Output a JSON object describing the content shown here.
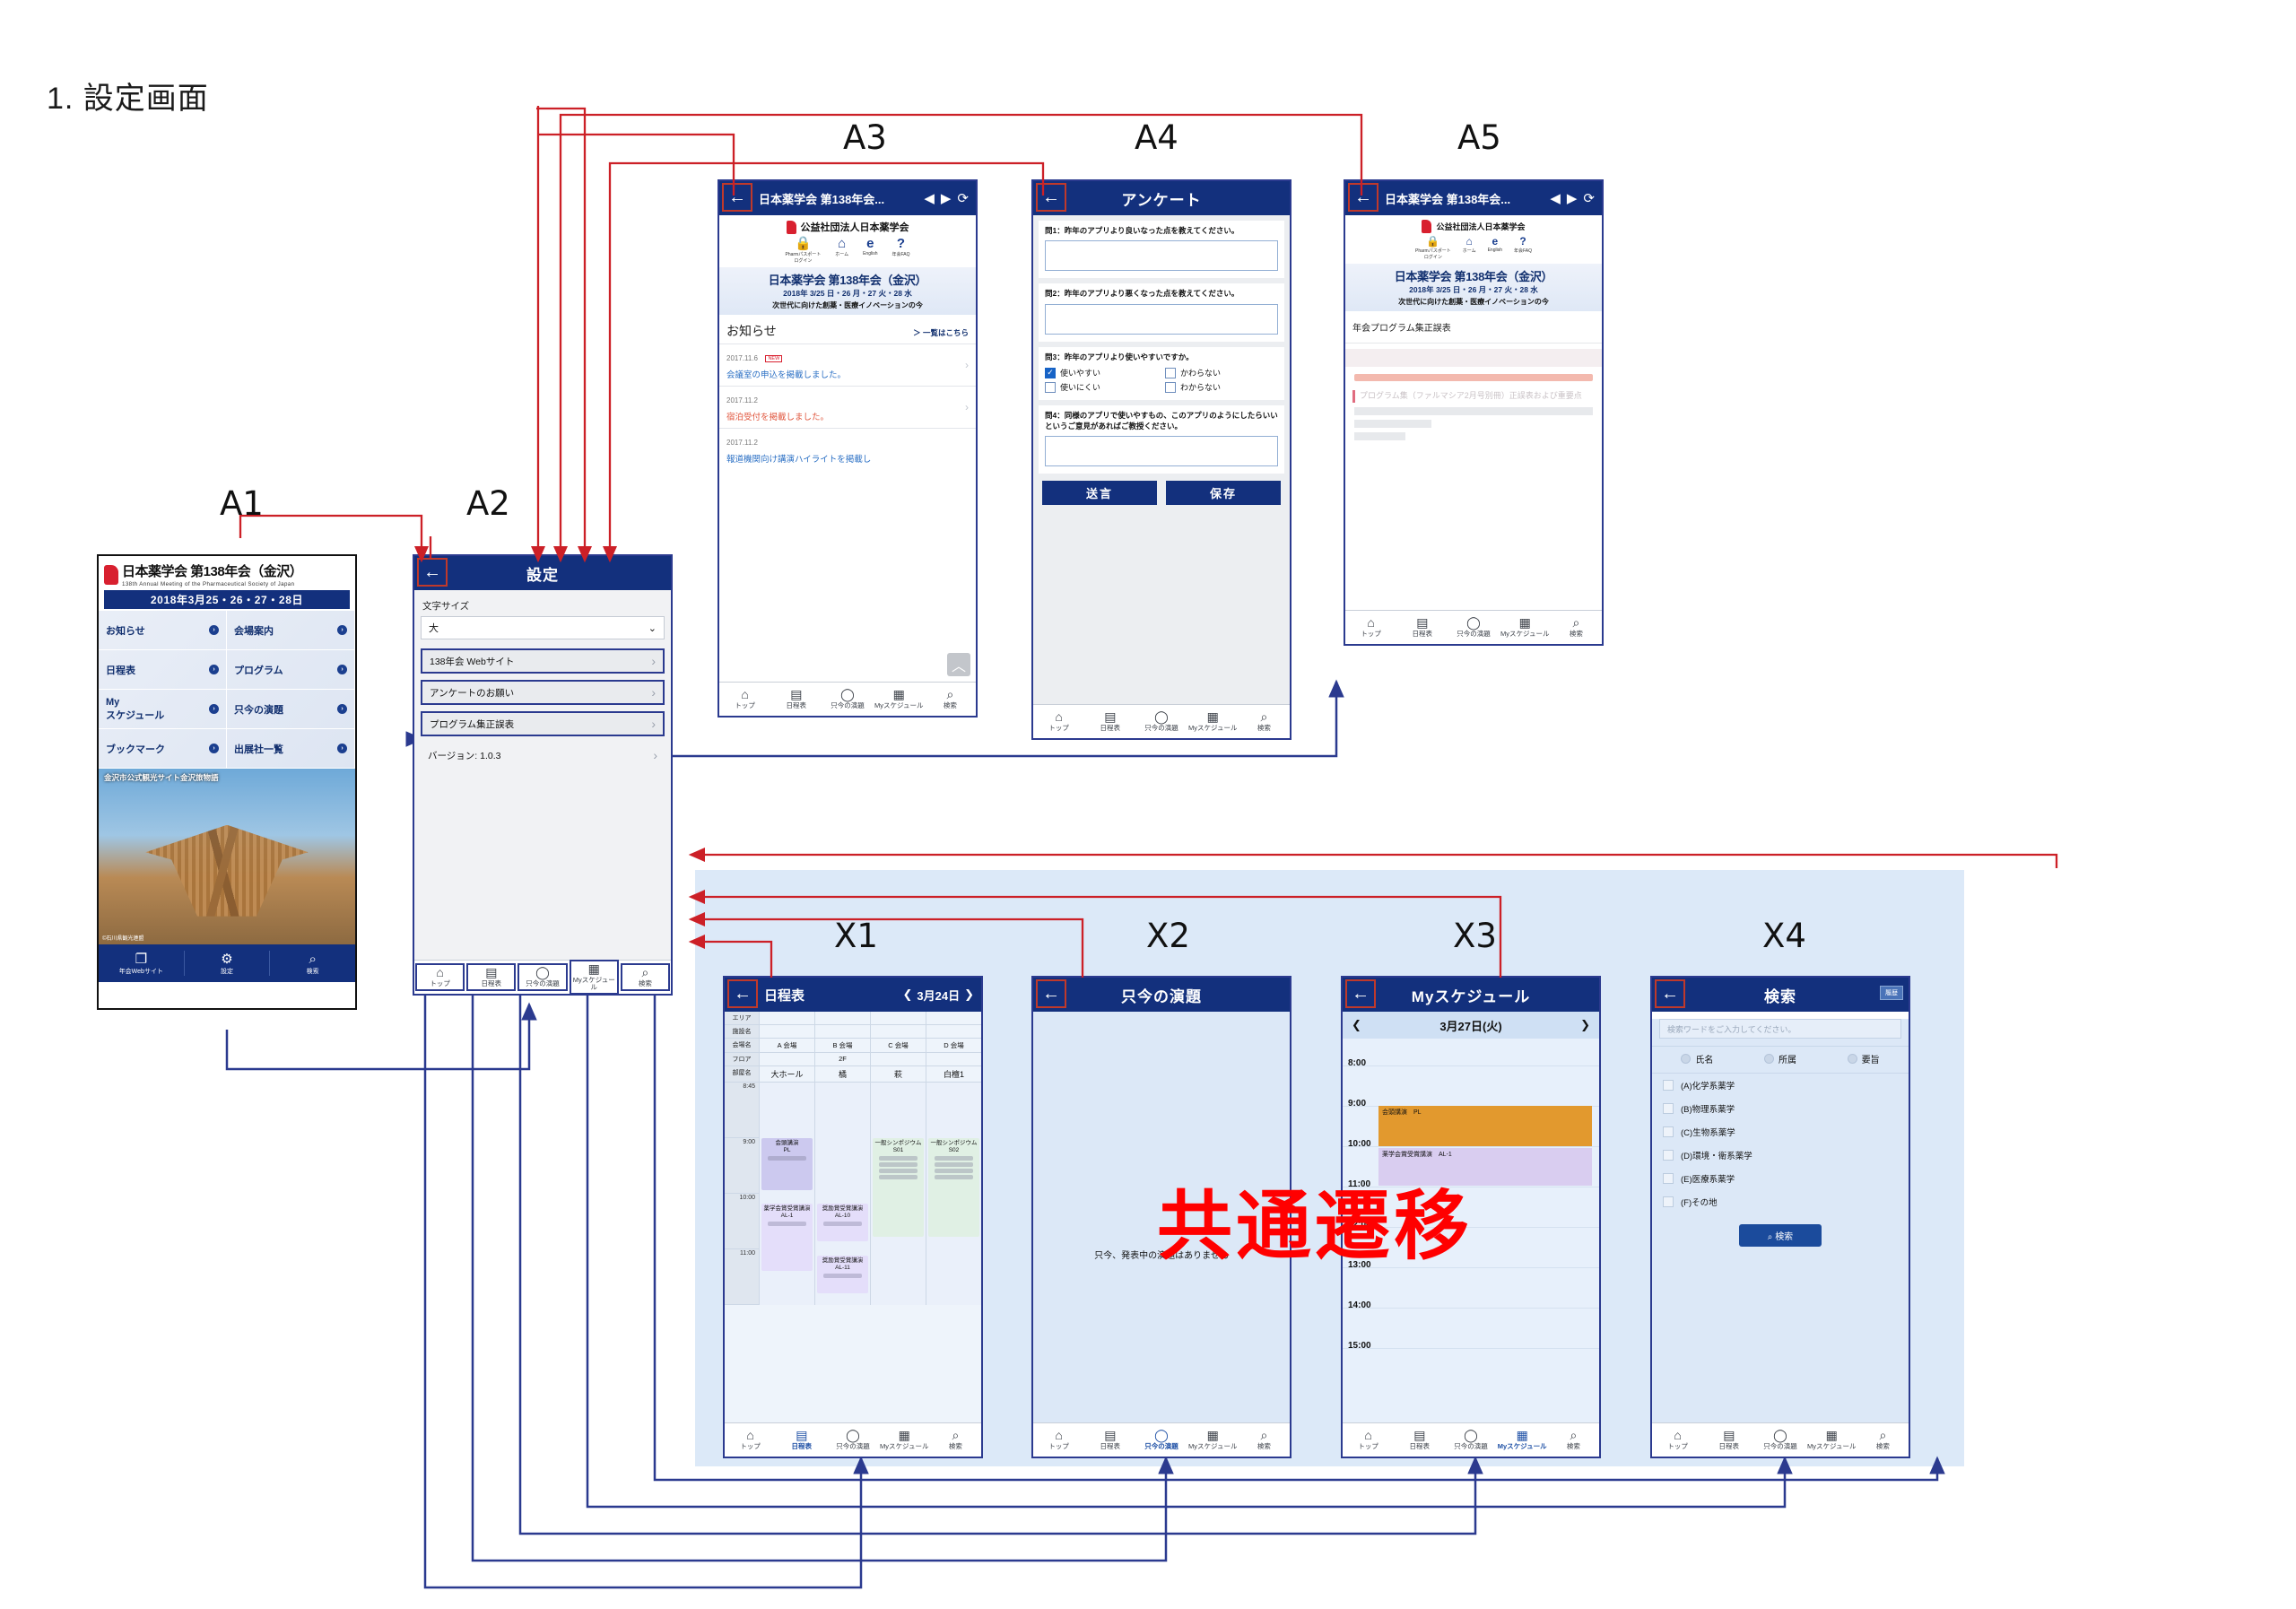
{
  "page": {
    "title": "1. 設定画面"
  },
  "watermark": "共通遷移",
  "labels": {
    "a1": "A1",
    "a2": "A2",
    "a3": "A3",
    "a4": "A4",
    "a5": "A5",
    "x1": "X1",
    "x2": "X2",
    "x3": "X3",
    "x4": "X4"
  },
  "nav": {
    "top": "トップ",
    "schedule": "日程表",
    "now": "只今の演題",
    "myschedule": "Myスケジュール",
    "search": "検索",
    "icons": {
      "top": "⌂",
      "schedule": "▤",
      "now": "◯",
      "myschedule": "▦",
      "search": "⌕"
    }
  },
  "a1": {
    "brand_title": "日本薬学会 第138年会（金沢）",
    "brand_sub": "138th Annual Meeting of the Pharmaceutical Society of Japan",
    "date_band": "2018年3月25・26・27・28日",
    "menu": [
      "お知らせ",
      "会場案内",
      "日程表",
      "プログラム",
      "My\nスケジュール",
      "只今の演題",
      "ブックマーク",
      "出展社一覧"
    ],
    "photo_caption": "金沢市公式観光サイト金沢旅物語",
    "photo_credit": "©石川県観光連盟",
    "bottom_nav": [
      "年会Webサイト",
      "設定",
      "検索"
    ],
    "bottom_icons": [
      "❐",
      "⚙",
      "⌕"
    ]
  },
  "a2": {
    "title": "設定",
    "fontsize_label": "文字サイズ",
    "fontsize_value": "大",
    "rows": [
      "138年会 Webサイト",
      "アンケートのお願い",
      "プログラム集正誤表",
      "バージョン: 1.0.3"
    ]
  },
  "a3": {
    "browser_title": "日本薬学会 第138年会...",
    "society_name": "公益社団法人日本薬学会",
    "quick_icons": [
      {
        "glyph": "🔒",
        "caption": "Pharmパスポート\nログイン"
      },
      {
        "glyph": "⌂",
        "caption": "ホーム"
      },
      {
        "glyph": "e",
        "caption": "English"
      },
      {
        "glyph": "?",
        "caption": "年会FAQ"
      }
    ],
    "banner_line1": "日本薬学会 第138年会（金沢）",
    "banner_line2": "2018年 3/25 日・26 月・27 火・28 水",
    "banner_line3": "次世代に向けた創薬・医療イノベーションの今",
    "news_heading": "お知らせ",
    "news_more": "＞ 一覧はこちら",
    "news": [
      {
        "date": "2017.11.6",
        "badge": "NEW",
        "text": "会議室の申込を掲載しました。",
        "color": "blue"
      },
      {
        "date": "2017.11.2",
        "badge": "",
        "text": "宿泊受付を掲載しました。",
        "color": "red"
      },
      {
        "date": "2017.11.2",
        "badge": "",
        "text": "報道機関向け講演ハイライトを掲載し",
        "color": "blue"
      }
    ]
  },
  "a4": {
    "title": "アンケート",
    "questions": [
      {
        "q": "問1：昨年のアプリより良いなった点を教えてください。",
        "type": "text"
      },
      {
        "q": "問2：昨年のアプリより悪くなった点を教えてください。",
        "type": "text"
      },
      {
        "q": "問3：昨年のアプリより使いやすいですか。",
        "type": "check",
        "options": [
          {
            "label": "使いやすい",
            "checked": true
          },
          {
            "label": "かわらない",
            "checked": false
          },
          {
            "label": "使いにくい",
            "checked": false
          },
          {
            "label": "わからない",
            "checked": false
          }
        ]
      },
      {
        "q": "問4：同様のアプリで使いやすもの、このアプリのようにしたらいいというご意見があればご教授ください。",
        "type": "text"
      }
    ],
    "submit": "送言",
    "save": "保存"
  },
  "a5": {
    "browser_title": "日本薬学会 第138年会...",
    "page_heading": "年会プログラム集正誤表"
  },
  "x1": {
    "title": "日程表",
    "date": "3月24日",
    "row_headers": [
      "エリア",
      "施設名",
      "会場名",
      "フロア",
      "部屋名"
    ],
    "halls": [
      "A 会場",
      "B 会場",
      "C 会場",
      "D 会場"
    ],
    "floor": "2F",
    "rooms": [
      "大ホール",
      "橘",
      "萩",
      "白檀1"
    ],
    "times": [
      "8:45",
      "9:00",
      "10:00",
      "11:00"
    ],
    "events": [
      {
        "col": 0,
        "title": "会頭講演\nPL"
      },
      {
        "col": 2,
        "title": "一般シンポジウム　S01"
      },
      {
        "col": 3,
        "title": "一般シンポジウム　S02"
      },
      {
        "col": 0,
        "title": "薬学会賞受賞講演\nAL-1"
      },
      {
        "col": 1,
        "title": "奨励賞受賞講演　AL-10"
      },
      {
        "col": 1,
        "title": "奨励賞受賞講演　AL-11"
      }
    ]
  },
  "x2": {
    "title": "只今の演題",
    "empty_text": "只今、発表中の演題はありません"
  },
  "x3": {
    "title": "Myスケジュール",
    "date": "3月27日(火)",
    "prev": "❮",
    "next": "❯",
    "times": [
      "8:00",
      "9:00",
      "10:00",
      "11:00",
      "12:00",
      "13:00",
      "14:00",
      "15:00"
    ],
    "events": [
      {
        "label": "会頭講演　PL",
        "color": "#e2992e",
        "start": "9:00",
        "end": "10:00"
      },
      {
        "label": "薬学会賞受賞講演　AL-1",
        "color": "#d9cdf0",
        "start": "10:00",
        "end": "11:00"
      }
    ]
  },
  "x4": {
    "title": "検索",
    "history": "履歴",
    "placeholder": "検索ワードをご入力してください。",
    "radios": [
      "氏名",
      "所属",
      "要旨"
    ],
    "categories": [
      "(A)化学系薬学",
      "(B)物理系薬学",
      "(C)生物系薬学",
      "(D)環境・衛系薬学",
      "(E)医療系薬学",
      "(F)その地"
    ],
    "search_button": "検索"
  },
  "colors": {
    "navy": "#13307d",
    "arrow_red": "#cc2027",
    "arrow_blue": "#2b3a8f",
    "common_bg": "#dce9f8"
  }
}
